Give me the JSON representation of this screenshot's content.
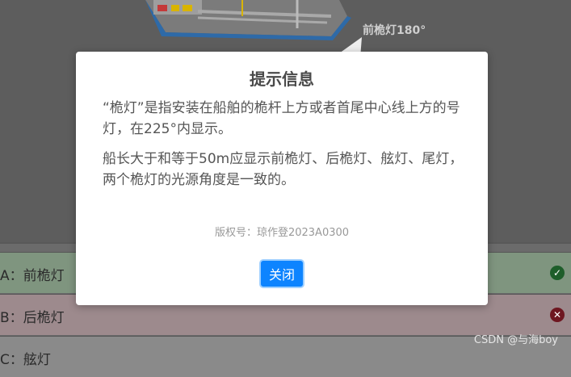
{
  "scene": {
    "light_label": "前桅灯180°"
  },
  "options": [
    {
      "label": "A：前桅灯",
      "status": "correct",
      "icon": "check-circle-icon"
    },
    {
      "label": "B：后桅灯",
      "status": "wrong",
      "icon": "x-circle-icon"
    },
    {
      "label": "C：舷灯",
      "status": "none",
      "icon": ""
    }
  ],
  "dialog": {
    "title": "提示信息",
    "paragraph1": "“桅灯”是指安装在船舶的桅杆上方或者首尾中心线上方的号灯，在225°内显示。",
    "paragraph2": "船长大于和等于50m应显示前桅灯、后桅灯、舷灯、尾灯，两个桅灯的光源角度是一致的。",
    "copyright": "版权号：琼作登2023A0300",
    "close_label": "关闭"
  },
  "watermark": "CSDN @与海boy",
  "colors": {
    "accent": "#0d84ff",
    "correct": "#1e5e2a",
    "wrong": "#6e1620"
  }
}
